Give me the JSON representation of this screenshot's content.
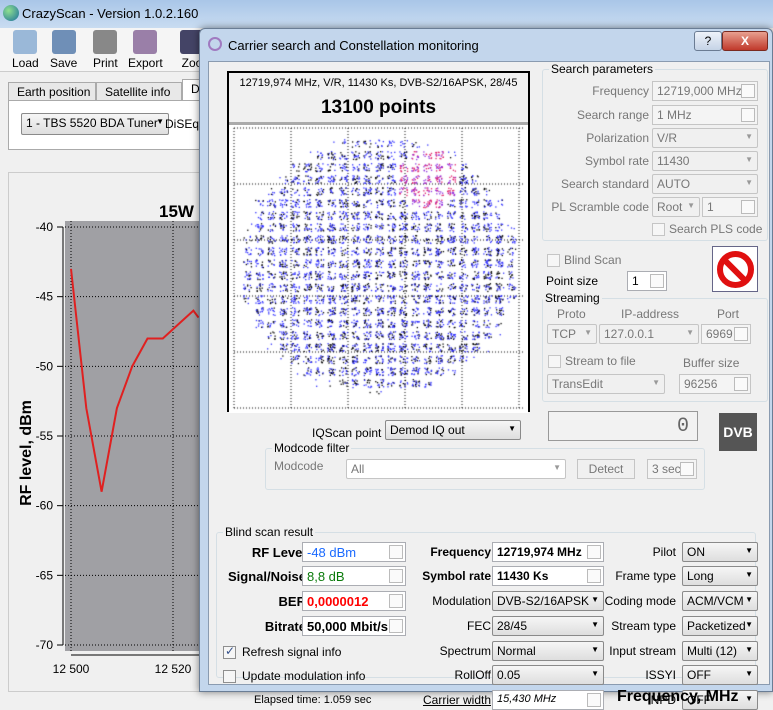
{
  "app": {
    "title": "CrazyScan - Version 1.0.2.160"
  },
  "toolbar": {
    "load": "Load",
    "save": "Save",
    "print": "Print",
    "export": "Export",
    "zoom": "Zoo"
  },
  "tabs": [
    "Earth position",
    "Satellite info",
    "D"
  ],
  "tuner": {
    "selected": "1 - TBS 5520 BDA Tuner",
    "diseqc": "DiSEqC"
  },
  "chart_data": {
    "type": "line",
    "title": "15W",
    "ylabel": "RF level, dBm",
    "xlabel": "Frequency, MHz",
    "ylim": [
      -70,
      -40
    ],
    "yticks": [
      -40,
      -45,
      -50,
      -55,
      -60,
      -65,
      -70
    ],
    "xticks": [
      "12 500",
      "12 520"
    ],
    "grid": true,
    "series": [
      {
        "name": "RF level",
        "color": "#e02020",
        "x": [
          12500,
          12503,
          12506,
          12509,
          12512,
          12515,
          12518,
          12521,
          12524,
          12525
        ],
        "y": [
          -43,
          -53,
          -59,
          -53,
          -50,
          -48,
          -48,
          -47,
          -46,
          -46.5
        ]
      }
    ]
  },
  "dialog": {
    "title": "Carrier search and Constellation monitoring",
    "help": "?",
    "close": "X",
    "constellation": {
      "header": "12719,974 MHz, V/R, 11430 Ks, DVB-S2/16APSK, 28/45",
      "points_label": "13100 points"
    },
    "search": {
      "title": "Search parameters",
      "frequency_label": "Frequency",
      "frequency": "12719,000 MHz",
      "range_label": "Search range",
      "range": "1 MHz",
      "pol_label": "Polarization",
      "pol": "V/R",
      "sr_label": "Symbol rate",
      "sr": "11430",
      "std_label": "Search standard",
      "std": "AUTO",
      "pls_label": "PL Scramble code",
      "pls_mode": "Root",
      "pls_value": "1",
      "search_pls": "Search PLS code"
    },
    "blind_scan": "Blind Scan",
    "point_size_label": "Point size",
    "point_size": "1",
    "streaming": {
      "title": "Streaming",
      "proto_h": "Proto",
      "ip_h": "IP-address",
      "port_h": "Port",
      "proto": "TCP",
      "ip": "127.0.0.1",
      "port": "6969",
      "to_file": "Stream to file",
      "buffer_h": "Buffer size",
      "target": "TransEdit",
      "buffer": "96256"
    },
    "counter": "0",
    "dvb_logo": "DVB",
    "iqscan_label": "IQScan point",
    "iqscan": "Demod IQ out",
    "modcode": {
      "title": "Modcode filter",
      "label": "Modcode",
      "value": "All",
      "detect": "Detect",
      "time": "3 sec"
    },
    "result": {
      "title": "Blind scan result",
      "rf_label": "RF Level",
      "rf": "-48 dBm",
      "snr_label": "Signal/Noise",
      "snr": "8,8 dB",
      "ber_label": "BER",
      "ber": "0,0000012",
      "bitrate_label": "Bitrate",
      "bitrate": "50,000 Mbit/s",
      "refresh": "Refresh signal info",
      "update_mod": "Update modulation info",
      "elapsed": "Elapsed time: 1.059 sec",
      "freq_label": "Frequency",
      "freq": "12719,974 MHz",
      "sr_label": "Symbol rate",
      "sr": "11430 Ks",
      "mod_label": "Modulation",
      "mod": "DVB-S2/16APSK",
      "fec_label": "FEC",
      "fec": "28/45",
      "spectrum_label": "Spectrum",
      "spectrum": "Normal",
      "rolloff_label": "RollOff",
      "rolloff": "0.05",
      "cw_label": "Carrier width",
      "cw": "15,430 MHz",
      "pilot_label": "Pilot",
      "pilot": "ON",
      "frame_label": "Frame type",
      "frame": "Long",
      "coding_label": "Coding mode",
      "coding": "ACM/VCM",
      "stream_label": "Stream type",
      "stream": "Packetized",
      "input_label": "Input stream",
      "input": "Multi (12)",
      "issyi_label": "ISSYI",
      "issyi": "OFF",
      "npd_label": "NPD",
      "npd": "OFF"
    },
    "colors": {
      "rf": "#1a6aff",
      "snr": "#0a7a0a",
      "ber": "#ff0000"
    }
  }
}
